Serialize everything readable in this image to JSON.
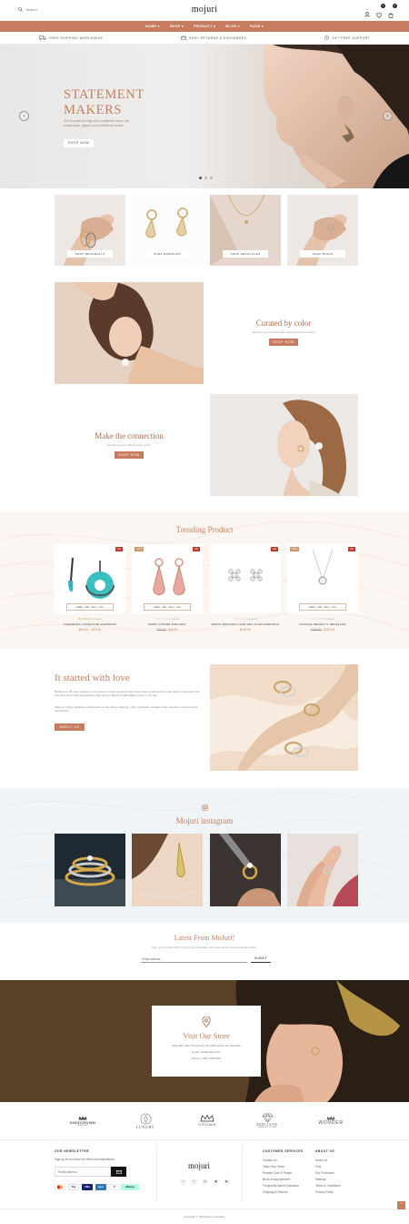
{
  "header": {
    "search_placeholder": "Search",
    "logo": "mojuri",
    "cart_count": "0",
    "wishlist_count": "0"
  },
  "nav": {
    "items": [
      {
        "label": "HOME ▾"
      },
      {
        "label": "SHOP ▾"
      },
      {
        "label": "PRODUCT ▾"
      },
      {
        "label": "BLOG ▾"
      },
      {
        "label": "PAGE ▾"
      }
    ]
  },
  "features": [
    {
      "label": "FREE SHIPPING WORLDWIDE"
    },
    {
      "label": "EASY RETURNS & EXCHANGES"
    },
    {
      "label": "24/7 FREE SUPPORT"
    }
  ],
  "hero": {
    "title_line1": "STATEMENT",
    "title_line2": "MAKERS",
    "subtitle": "Set of crystal earrings with a statement stone that boasts large, playful, and embellished details.",
    "button": "SHOP NOW"
  },
  "categories": [
    {
      "label": "SHOP BRACELETS"
    },
    {
      "label": "SHOP EARRINGS"
    },
    {
      "label": "SHOP NECKLACES"
    },
    {
      "label": "SHOP RINGS"
    }
  ],
  "promo1": {
    "title": "Curated by color",
    "subtitle": "Whether you look cool with mixed gemstone jewelry.",
    "button": "SHOP NOW"
  },
  "promo2": {
    "title": "Make the connection",
    "subtitle": "Introducing your dainty wearing hub.",
    "button": "SHOP NOW"
  },
  "trending": {
    "title": "Trending Product",
    "products": [
      {
        "name": "TIGEREYES TURQUOISE EARRINGS",
        "price_old": "",
        "price": "$40.00 – $75.00",
        "countdown": "293d : 10h : 52m : 47s",
        "tags": [
          "Hot"
        ],
        "reviews": "0 review"
      },
      {
        "name": "DROP CITRINE ZIRCONIA",
        "price_old": "$70.00",
        "price": "$30.00",
        "countdown": "293d : 10h : 52m : 47s",
        "tags": [
          "-10%",
          "Hot"
        ],
        "reviews": "0 review"
      },
      {
        "name": "BURIS ZIRCONIA CLAW SET STUD EARRINGS",
        "price_old": "",
        "price": "$100.00",
        "countdown": "",
        "tags": [
          "Hot"
        ],
        "reviews": "0 review"
      },
      {
        "name": "VINTAGE PEDANT'S NECKLACE",
        "price_old": "$290.00",
        "price": "$230.00",
        "countdown": "330d : 10h : 52m : 47s",
        "tags": [
          "-15%",
          "Hot"
        ],
        "reviews": "0 review"
      }
    ]
  },
  "story": {
    "title": "It started with love",
    "p1": "Behind our 25-year success is our panel of expert jewellers who have been scouring the entire globe in pursuit of the best and most stunning jewellery that can be offered at affordable prices to the day.",
    "p2": "Visit our online catalogue and browse for the latest earrings, rings, bracelets, necklace sets, and the most luxurious gemstones.",
    "button": "ABOUT US"
  },
  "instagram": {
    "title": "Mojuri instagram"
  },
  "newsletter": {
    "title": "Latest From MoJuri!",
    "subtitle": "Sign up to receive 10% off your next purchase. Plus hear about new arrivals and offers.",
    "placeholder": "Email address...",
    "button": "SUBMIT"
  },
  "store": {
    "title": "Visit Our Store",
    "address": "Suite 561, Nam Theres Rd. 50, 2200 Gartor St, Denmark",
    "email": "Email: info@mojuri.com",
    "phone": "Phone: (+84) 7748 2516"
  },
  "brands": [
    {
      "name": "KINGCROWN",
      "sub": "JEWELRY"
    },
    {
      "name": "LUXURY",
      "sub": ""
    },
    {
      "name": "CROWN",
      "sub": ""
    },
    {
      "name": "BERLIANA",
      "sub": "JEWELRY STORE"
    },
    {
      "name": "WONDER",
      "sub": ""
    }
  ],
  "footer": {
    "newsletter_heading": "OUR NEWSLETTER",
    "newsletter_text": "Sign up for our store for offers and inspirations.",
    "email_placeholder": "Email address...",
    "logo": "mojuri",
    "services_heading": "CUSTOMER SERVICES",
    "services": [
      "Contact Us",
      "Track Your Order",
      "Product Care & Repair",
      "Book an Appointment",
      "Frequently Asked Questions",
      "Shipping & Returns"
    ],
    "about_heading": "ABOUT US",
    "about": [
      "About Us",
      "FAQ",
      "Our Producers",
      "Sitemap",
      "Terms & Conditions",
      "Privacy Policy"
    ],
    "payments": [
      "MC",
      "Pay",
      "VISA",
      "AMEX",
      "P",
      "afterpay"
    ],
    "socials": [
      "t",
      "f",
      "◎",
      "◉",
      "▶"
    ],
    "copyright": "Copyright © 2022 Mojuri Jewellery"
  },
  "colors": {
    "accent": "#c77c60",
    "accent_text": "#c0805f",
    "store_bg": "#5c4028"
  }
}
